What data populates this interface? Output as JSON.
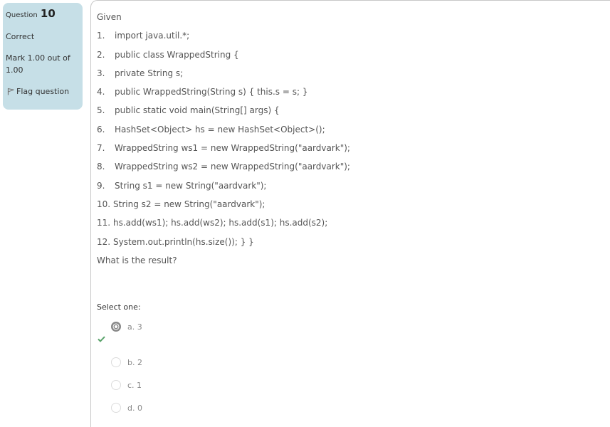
{
  "info": {
    "question_label": "Question",
    "question_number": "10",
    "state": "Correct",
    "grade": "Mark 1.00 out of 1.00",
    "flag_label": "Flag question"
  },
  "question": {
    "intro": "Given",
    "lines": [
      {
        "num": "1.",
        "code": "import java.util.*;"
      },
      {
        "num": "2.",
        "code": "public class WrappedString {"
      },
      {
        "num": "3.",
        "code": "private String s;"
      },
      {
        "num": "4.",
        "code": "public WrappedString(String s) { this.s = s; }"
      },
      {
        "num": "5.",
        "code": "public static void main(String[] args) {"
      },
      {
        "num": "6.",
        "code": "HashSet<Object> hs = new HashSet<Object>();"
      },
      {
        "num": "7.",
        "code": "WrappedString ws1 = new WrappedString(\"aardvark\");"
      },
      {
        "num": "8.",
        "code": "WrappedString ws2 = new WrappedString(\"aardvark\");"
      },
      {
        "num": "9.",
        "code": "String s1 = new String(\"aardvark\");"
      },
      {
        "num": "10.",
        "code": "String s2 = new String(\"aardvark\");"
      },
      {
        "num": "11.",
        "code": "hs.add(ws1); hs.add(ws2); hs.add(s1); hs.add(s2);"
      },
      {
        "num": "12.",
        "code": "System.out.println(hs.size()); } }"
      }
    ],
    "prompt": "What is the result?"
  },
  "answer": {
    "select_label": "Select one:",
    "options": [
      {
        "label": "a. 3",
        "selected": true,
        "correct": true
      },
      {
        "label": "b. 2",
        "selected": false
      },
      {
        "label": "c. 1",
        "selected": false
      },
      {
        "label": "d. 0",
        "selected": false
      }
    ],
    "check_color": "#5aa36b"
  },
  "colors": {
    "info_bg": "#c6dfe7",
    "selected_radio": "#888888"
  }
}
